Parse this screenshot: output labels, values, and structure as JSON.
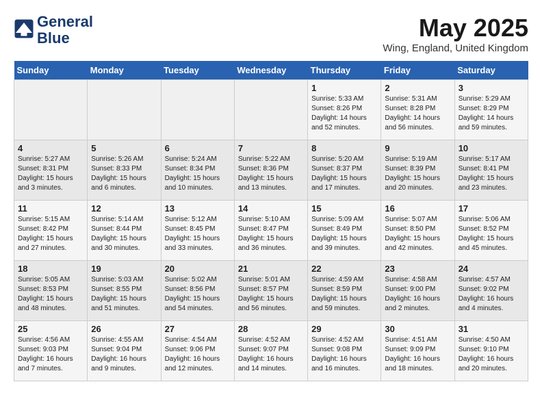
{
  "logo": {
    "line1": "General",
    "line2": "Blue"
  },
  "title": "May 2025",
  "location": "Wing, England, United Kingdom",
  "weekdays": [
    "Sunday",
    "Monday",
    "Tuesday",
    "Wednesday",
    "Thursday",
    "Friday",
    "Saturday"
  ],
  "weeks": [
    [
      {
        "day": "",
        "info": ""
      },
      {
        "day": "",
        "info": ""
      },
      {
        "day": "",
        "info": ""
      },
      {
        "day": "",
        "info": ""
      },
      {
        "day": "1",
        "info": "Sunrise: 5:33 AM\nSunset: 8:26 PM\nDaylight: 14 hours\nand 52 minutes."
      },
      {
        "day": "2",
        "info": "Sunrise: 5:31 AM\nSunset: 8:28 PM\nDaylight: 14 hours\nand 56 minutes."
      },
      {
        "day": "3",
        "info": "Sunrise: 5:29 AM\nSunset: 8:29 PM\nDaylight: 14 hours\nand 59 minutes."
      }
    ],
    [
      {
        "day": "4",
        "info": "Sunrise: 5:27 AM\nSunset: 8:31 PM\nDaylight: 15 hours\nand 3 minutes."
      },
      {
        "day": "5",
        "info": "Sunrise: 5:26 AM\nSunset: 8:33 PM\nDaylight: 15 hours\nand 6 minutes."
      },
      {
        "day": "6",
        "info": "Sunrise: 5:24 AM\nSunset: 8:34 PM\nDaylight: 15 hours\nand 10 minutes."
      },
      {
        "day": "7",
        "info": "Sunrise: 5:22 AM\nSunset: 8:36 PM\nDaylight: 15 hours\nand 13 minutes."
      },
      {
        "day": "8",
        "info": "Sunrise: 5:20 AM\nSunset: 8:37 PM\nDaylight: 15 hours\nand 17 minutes."
      },
      {
        "day": "9",
        "info": "Sunrise: 5:19 AM\nSunset: 8:39 PM\nDaylight: 15 hours\nand 20 minutes."
      },
      {
        "day": "10",
        "info": "Sunrise: 5:17 AM\nSunset: 8:41 PM\nDaylight: 15 hours\nand 23 minutes."
      }
    ],
    [
      {
        "day": "11",
        "info": "Sunrise: 5:15 AM\nSunset: 8:42 PM\nDaylight: 15 hours\nand 27 minutes."
      },
      {
        "day": "12",
        "info": "Sunrise: 5:14 AM\nSunset: 8:44 PM\nDaylight: 15 hours\nand 30 minutes."
      },
      {
        "day": "13",
        "info": "Sunrise: 5:12 AM\nSunset: 8:45 PM\nDaylight: 15 hours\nand 33 minutes."
      },
      {
        "day": "14",
        "info": "Sunrise: 5:10 AM\nSunset: 8:47 PM\nDaylight: 15 hours\nand 36 minutes."
      },
      {
        "day": "15",
        "info": "Sunrise: 5:09 AM\nSunset: 8:49 PM\nDaylight: 15 hours\nand 39 minutes."
      },
      {
        "day": "16",
        "info": "Sunrise: 5:07 AM\nSunset: 8:50 PM\nDaylight: 15 hours\nand 42 minutes."
      },
      {
        "day": "17",
        "info": "Sunrise: 5:06 AM\nSunset: 8:52 PM\nDaylight: 15 hours\nand 45 minutes."
      }
    ],
    [
      {
        "day": "18",
        "info": "Sunrise: 5:05 AM\nSunset: 8:53 PM\nDaylight: 15 hours\nand 48 minutes."
      },
      {
        "day": "19",
        "info": "Sunrise: 5:03 AM\nSunset: 8:55 PM\nDaylight: 15 hours\nand 51 minutes."
      },
      {
        "day": "20",
        "info": "Sunrise: 5:02 AM\nSunset: 8:56 PM\nDaylight: 15 hours\nand 54 minutes."
      },
      {
        "day": "21",
        "info": "Sunrise: 5:01 AM\nSunset: 8:57 PM\nDaylight: 15 hours\nand 56 minutes."
      },
      {
        "day": "22",
        "info": "Sunrise: 4:59 AM\nSunset: 8:59 PM\nDaylight: 15 hours\nand 59 minutes."
      },
      {
        "day": "23",
        "info": "Sunrise: 4:58 AM\nSunset: 9:00 PM\nDaylight: 16 hours\nand 2 minutes."
      },
      {
        "day": "24",
        "info": "Sunrise: 4:57 AM\nSunset: 9:02 PM\nDaylight: 16 hours\nand 4 minutes."
      }
    ],
    [
      {
        "day": "25",
        "info": "Sunrise: 4:56 AM\nSunset: 9:03 PM\nDaylight: 16 hours\nand 7 minutes."
      },
      {
        "day": "26",
        "info": "Sunrise: 4:55 AM\nSunset: 9:04 PM\nDaylight: 16 hours\nand 9 minutes."
      },
      {
        "day": "27",
        "info": "Sunrise: 4:54 AM\nSunset: 9:06 PM\nDaylight: 16 hours\nand 12 minutes."
      },
      {
        "day": "28",
        "info": "Sunrise: 4:52 AM\nSunset: 9:07 PM\nDaylight: 16 hours\nand 14 minutes."
      },
      {
        "day": "29",
        "info": "Sunrise: 4:52 AM\nSunset: 9:08 PM\nDaylight: 16 hours\nand 16 minutes."
      },
      {
        "day": "30",
        "info": "Sunrise: 4:51 AM\nSunset: 9:09 PM\nDaylight: 16 hours\nand 18 minutes."
      },
      {
        "day": "31",
        "info": "Sunrise: 4:50 AM\nSunset: 9:10 PM\nDaylight: 16 hours\nand 20 minutes."
      }
    ]
  ]
}
